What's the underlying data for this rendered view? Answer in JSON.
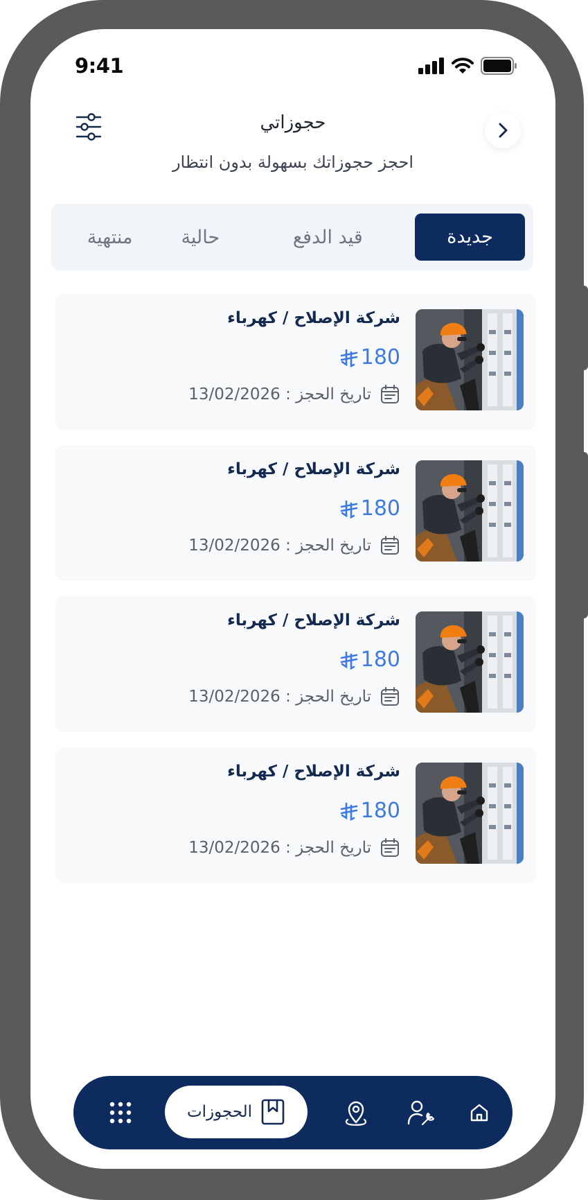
{
  "status_bar": {
    "time": "9:41"
  },
  "header": {
    "title": "حجوزاتي",
    "subtitle": "احجز حجوزاتك بسهولة بدون انتظار"
  },
  "tabs": [
    {
      "label": "جديدة",
      "active": true
    },
    {
      "label": "قيد الدفع",
      "active": false
    },
    {
      "label": "حالية",
      "active": false
    },
    {
      "label": "منتهية",
      "active": false
    }
  ],
  "bookings": [
    {
      "title": "شركة الإصلاح / كهرباء",
      "price": "180",
      "date": "تاريخ الحجز : 13/02/2026"
    },
    {
      "title": "شركة الإصلاح / كهرباء",
      "price": "180",
      "date": "تاريخ الحجز : 13/02/2026"
    },
    {
      "title": "شركة الإصلاح / كهرباء",
      "price": "180",
      "date": "تاريخ الحجز : 13/02/2026"
    },
    {
      "title": "شركة الإصلاح / كهرباء",
      "price": "180",
      "date": "تاريخ الحجز : 13/02/2026"
    }
  ],
  "bottom_nav": {
    "bookings_label": "الحجوزات",
    "icons": [
      "home-icon",
      "technician-icon",
      "location-icon",
      "bookmark-icon",
      "grid-menu-icon"
    ]
  },
  "colors": {
    "primary": "#0d2b5e",
    "price": "#3d7be3",
    "frame": "#5a5a5a",
    "tab_bg": "#f1f5fa",
    "card_bg": "#f8f9fa"
  }
}
